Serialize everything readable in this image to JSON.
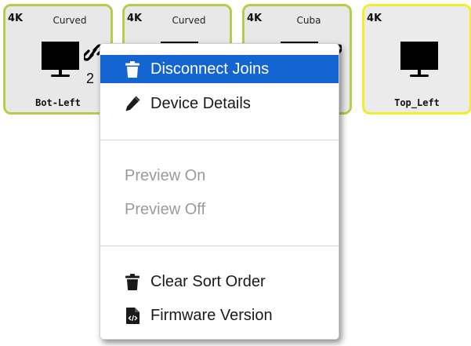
{
  "tiles": [
    {
      "resolution": "4K",
      "group": "Curved",
      "name": "Bot-Left",
      "count": "2",
      "border": "#b3cf4a"
    },
    {
      "resolution": "4K",
      "group": "Curved",
      "name": "",
      "count": "",
      "border": "#b3cf4a"
    },
    {
      "resolution": "4K",
      "group": "Cuba",
      "name": "",
      "count": "",
      "border": "#b3cf4a"
    },
    {
      "resolution": "4K",
      "group": "",
      "name": "Top_Left",
      "count": "",
      "border": "#f2ee2c"
    }
  ],
  "menu": {
    "items": [
      {
        "label": "Disconnect Joins",
        "icon": "trash-icon",
        "state": "highlighted"
      },
      {
        "label": "Device Details",
        "icon": "pencil-icon",
        "state": "enabled"
      },
      {
        "label": "Preview On",
        "icon": "",
        "state": "disabled"
      },
      {
        "label": "Preview Off",
        "icon": "",
        "state": "disabled"
      },
      {
        "label": "Clear Sort Order",
        "icon": "trash-icon",
        "state": "enabled"
      },
      {
        "label": "Firmware Version",
        "icon": "code-file-icon",
        "state": "enabled"
      }
    ],
    "highlight_color": "#1464d2"
  },
  "colors": {
    "tile_active_border": "#b3cf4a",
    "tile_selected_border": "#f2ee2c",
    "tile_bg": "#e8e8e8"
  }
}
